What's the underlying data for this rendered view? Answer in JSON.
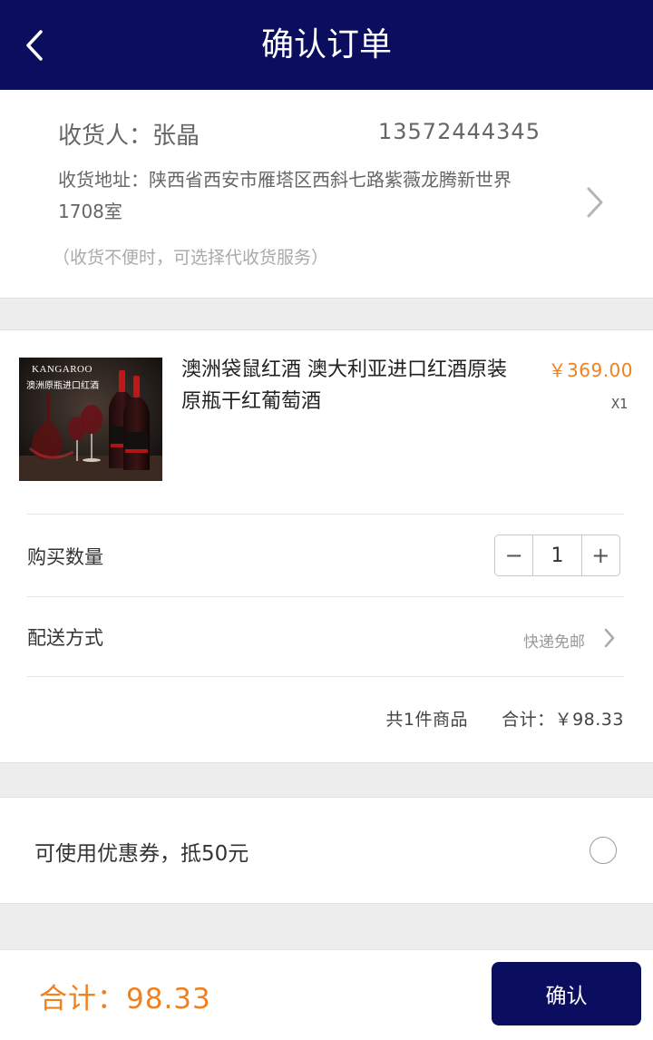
{
  "header": {
    "title": "确认订单",
    "back_icon": "chevron-left-icon"
  },
  "address": {
    "recipient": "收货人：张晶",
    "phone": "13572444345",
    "address_text": "收货地址：陕西省西安市雁塔区西斜七路紫薇龙腾新世界1708室",
    "note": "（收货不便时，可选择代收货服务）",
    "arrow_icon": "chevron-right-icon"
  },
  "product": {
    "image_brand": "KANGAROO",
    "image_caption": "澳洲原瓶进口红酒",
    "name": "澳洲袋鼠红酒 澳大利亚进口红酒原装原瓶干红葡萄酒",
    "price": "￥369.00",
    "qty_label": "X1"
  },
  "quantity": {
    "label": "购买数量",
    "value": "1",
    "minus": "−",
    "plus": "+"
  },
  "shipping": {
    "label": "配送方式",
    "value": "快递免邮"
  },
  "summary": {
    "items": "共1件商品",
    "total": "合计：￥98.33"
  },
  "coupon": {
    "label": "可使用优惠券，抵50元",
    "checked": false
  },
  "footer": {
    "total": "合计：98.33",
    "confirm_label": "确认"
  },
  "colors": {
    "brand_navy": "#0b0e5e",
    "accent_orange": "#f08020"
  }
}
